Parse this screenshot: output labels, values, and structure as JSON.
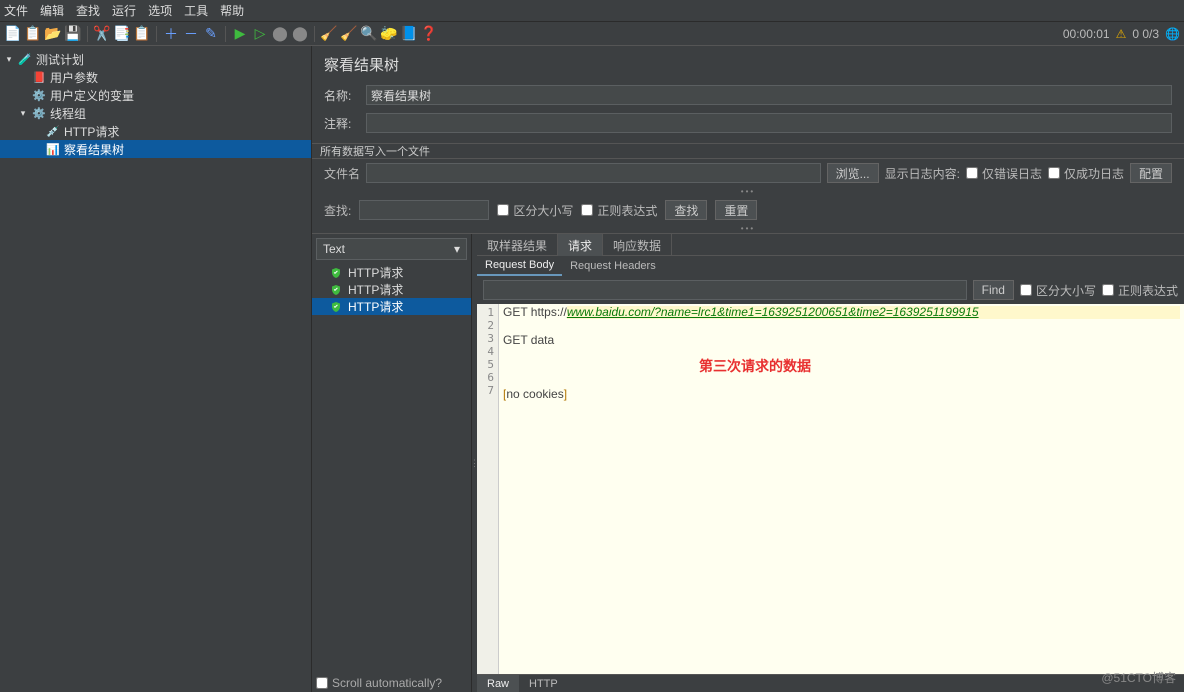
{
  "menu": {
    "items": [
      "文件",
      "编辑",
      "查找",
      "运行",
      "选项",
      "工具",
      "帮助"
    ]
  },
  "toolbar": {
    "timer": "00:00:01",
    "threads": "0  0/3"
  },
  "tree": {
    "plan": "测试计划",
    "user_params": "用户参数",
    "user_vars": "用户定义的变量",
    "thread_group": "线程组",
    "http_req": "HTTP请求",
    "view_results": "察看结果树"
  },
  "panel": {
    "title": "察看结果树",
    "name_label": "名称:",
    "name_value": "察看结果树",
    "comment_label": "注释:",
    "write_all": "所有数据写入一个文件",
    "filename_label": "文件名",
    "browse": "浏览...",
    "show_log": "显示日志内容:",
    "errors_only": "仅错误日志",
    "success_only": "仅成功日志",
    "configure": "配置",
    "search_label": "查找:",
    "case_sensitive": "区分大小写",
    "regex": "正则表达式",
    "search_btn": "查找",
    "reset_btn": "重置"
  },
  "render": {
    "select_value": "Text"
  },
  "results": {
    "items": [
      "HTTP请求",
      "HTTP请求",
      "HTTP请求"
    ]
  },
  "tabs": {
    "sampler": "取样器结果",
    "request": "请求",
    "response": "响应数据"
  },
  "subtabs": {
    "body": "Request Body",
    "headers": "Request Headers"
  },
  "find": {
    "btn": "Find",
    "case": "区分大小写",
    "regex": "正则表达式"
  },
  "code": {
    "line1_method": "GET ",
    "line1_scheme": "https://",
    "line1_url": "www.baidu.com/?name=lrc1&time1=1639251200651&time2=1639251199915",
    "line3": "GET data",
    "line6_b1": "[",
    "line6_txt": "no cookies",
    "line6_b2": "]"
  },
  "annotation": "第三次请求的数据",
  "footer": {
    "raw": "Raw",
    "http": "HTTP",
    "scroll_auto": "Scroll automatically?"
  },
  "watermark": "@51CTO博客"
}
